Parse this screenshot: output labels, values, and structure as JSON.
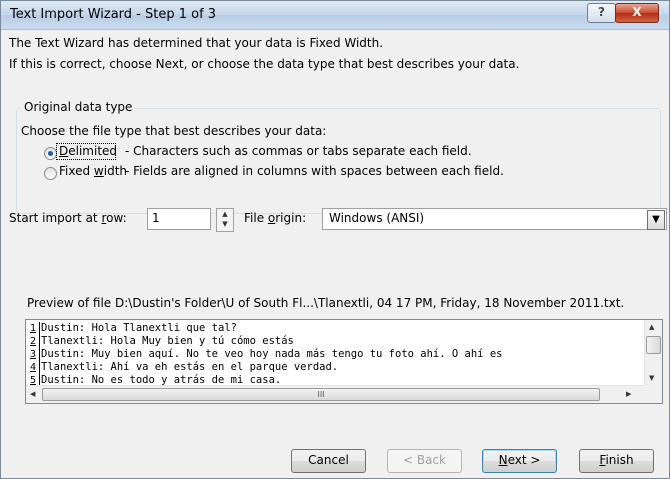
{
  "window": {
    "title": "Text Import Wizard - Step 1 of 3",
    "help_glyph": "?",
    "close_glyph": "X"
  },
  "intro": {
    "line1": "The Text Wizard has determined that your data is Fixed Width.",
    "line2": "If this is correct, choose Next, or choose the data type that best describes your data."
  },
  "group": {
    "legend": "Original data type",
    "prompt": "Choose the file type that best describes your data:",
    "options": [
      {
        "label": "Delimited",
        "description": "- Characters such as commas or tabs separate each field.",
        "selected": true
      },
      {
        "label": "Fixed width",
        "description": "- Fields are aligned in columns with spaces between each field.",
        "selected": false
      }
    ]
  },
  "start_row": {
    "label": "Start import at row:",
    "value": "1",
    "up_glyph": "▲",
    "down_glyph": "▼"
  },
  "file_origin": {
    "label": "File origin:",
    "value": "Windows (ANSI)",
    "arrow_glyph": "▼"
  },
  "preview": {
    "caption": "Preview of file D:\\Dustin's Folder\\U of South Fl...\\Tlanextli, 04 17 PM, Friday, 18 November 2011.txt.",
    "rows": [
      {
        "num": "1",
        "text": "Dustin: Hola Tlanextli que tal?"
      },
      {
        "num": "2",
        "text": "Tlanextli: Hola Muy bien y tú cómo estás"
      },
      {
        "num": "3",
        "text": "Dustin: Muy bien aquí. No te veo hoy nada más tengo tu foto ahí. O ahí es"
      },
      {
        "num": "4",
        "text": "Tlanextli: Ahí va eh estás en el parque verdad."
      },
      {
        "num": "5",
        "text": "Dustin: No es todo y atrás de mi casa."
      }
    ],
    "hscroll_grip": "III"
  },
  "buttons": {
    "cancel": "Cancel",
    "back": "< Back",
    "next": "Next >",
    "finish": "Finish"
  }
}
